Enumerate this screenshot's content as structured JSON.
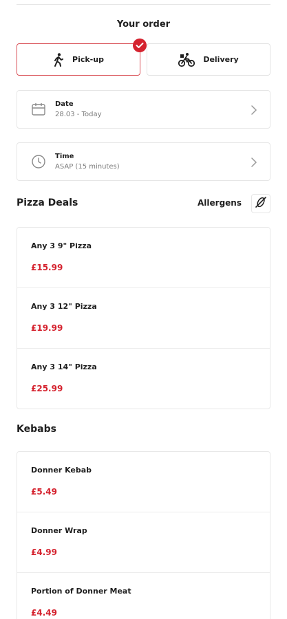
{
  "header": {
    "title": "Your order"
  },
  "mode": {
    "pickup_label": "Pick-up",
    "delivery_label": "Delivery",
    "selected": "pickup"
  },
  "date": {
    "label": "Date",
    "value": "28.03 - Today"
  },
  "time": {
    "label": "Time",
    "value": "ASAP (15 minutes)"
  },
  "pizza_deals": {
    "title": "Pizza Deals",
    "allergens_label": "Allergens",
    "items": [
      {
        "name": "Any 3 9\" Pizza",
        "price": "£15.99"
      },
      {
        "name": "Any 3 12\" Pizza",
        "price": "£19.99"
      },
      {
        "name": "Any 3 14\" Pizza",
        "price": "£25.99"
      }
    ]
  },
  "kebabs": {
    "title": "Kebabs",
    "items": [
      {
        "name": "Donner Kebab",
        "price": "£5.49"
      },
      {
        "name": "Donner Wrap",
        "price": "£4.99"
      },
      {
        "name": "Portion of Donner Meat",
        "price": "£4.49"
      }
    ]
  },
  "colors": {
    "accent": "#d5232f",
    "border": "#e6e6e6",
    "muted_text": "#7a7a7a"
  },
  "icons": {
    "pickup": "walking-person-icon",
    "delivery": "cyclist-icon",
    "selected": "check-icon",
    "date": "calendar-icon",
    "time": "clock-icon",
    "chevron": "chevron-right-icon",
    "allergens": "no-allergen-icon"
  }
}
